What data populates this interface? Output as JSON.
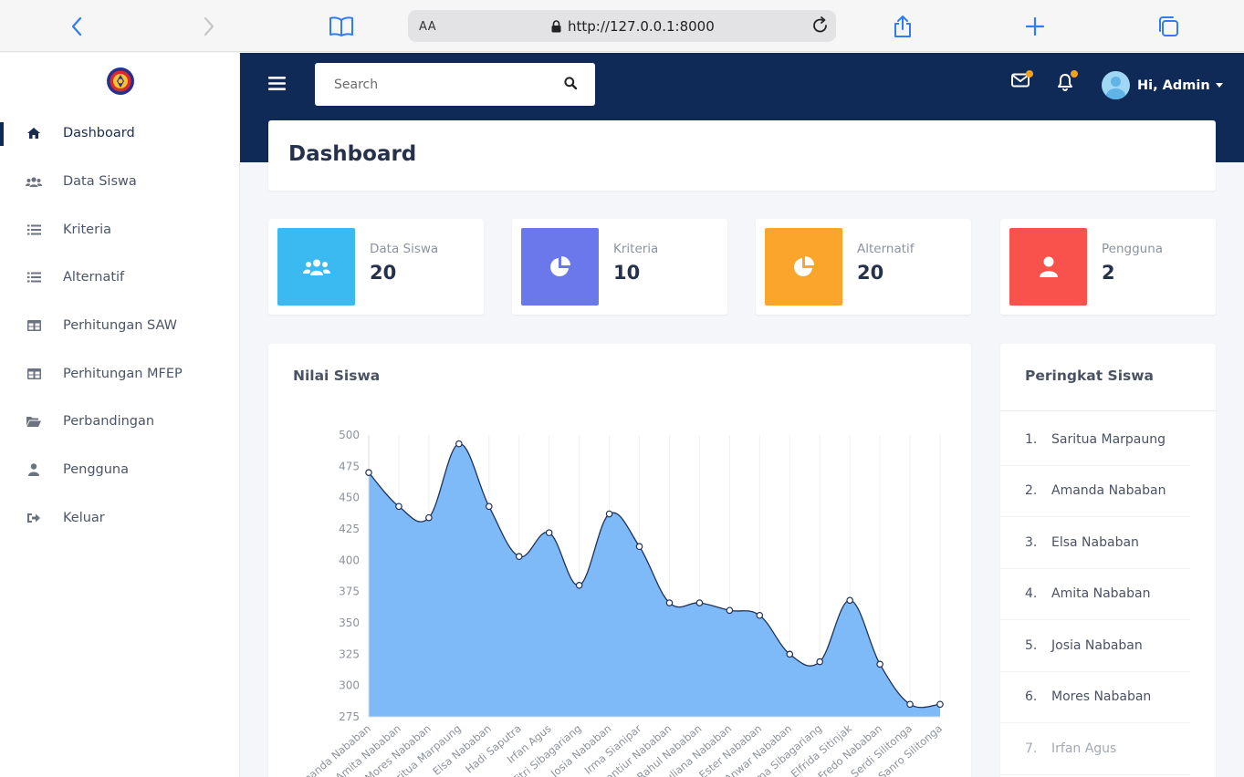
{
  "browser": {
    "text_size_label": "AA",
    "url": "http://127.0.0.1:8000"
  },
  "sidebar": {
    "items": [
      {
        "label": "Dashboard",
        "icon": "home-icon",
        "active": true
      },
      {
        "label": "Data Siswa",
        "icon": "users-icon"
      },
      {
        "label": "Kriteria",
        "icon": "list-icon"
      },
      {
        "label": "Alternatif",
        "icon": "list-icon"
      },
      {
        "label": "Perhitungan SAW",
        "icon": "table-icon"
      },
      {
        "label": "Perhitungan MFEP",
        "icon": "table-icon"
      },
      {
        "label": "Perbandingan",
        "icon": "folder-open-icon"
      },
      {
        "label": "Pengguna",
        "icon": "user-icon"
      },
      {
        "label": "Keluar",
        "icon": "sign-out-icon"
      }
    ]
  },
  "topbar": {
    "search_placeholder": "Search",
    "user_greeting": "Hi, Admin"
  },
  "page": {
    "title": "Dashboard"
  },
  "stats": [
    {
      "label": "Data Siswa",
      "value": "20",
      "color": "#3bbaf2",
      "icon": "users-icon"
    },
    {
      "label": "Kriteria",
      "value": "10",
      "color": "#6a78ec",
      "icon": "pie-chart-icon"
    },
    {
      "label": "Alternatif",
      "value": "20",
      "color": "#fca52c",
      "icon": "pie-chart-icon"
    },
    {
      "label": "Pengguna",
      "value": "2",
      "color": "#f9524c",
      "icon": "user-icon"
    }
  ],
  "chart": {
    "title": "Nilai Siswa"
  },
  "chart_data": {
    "type": "area",
    "title": "Nilai Siswa",
    "categories": [
      "Amanda Nababan",
      "Amita Nababan",
      "Mores Nababan",
      "Saritua Marpaung",
      "Elsa Nababan",
      "Hadi Saputra",
      "Irfan Agus",
      "Fitri Sibagariang",
      "Josia Nababan",
      "Irma Sianipar",
      "Mantiur Nababan",
      "Rahul Nababan",
      "Juliana Nababan",
      "Ester Nababan",
      "Anwar Nababan",
      "Nurma Sibagariang",
      "Elfrida Sitinjak",
      "Fredo Nababan",
      "Serdi Silitonga",
      "Sanro Silitonga"
    ],
    "values": [
      470,
      443,
      434,
      493,
      443,
      403,
      422,
      380,
      437,
      411,
      366,
      366,
      360,
      356,
      325,
      319,
      368,
      317,
      285,
      285
    ],
    "ylim": [
      275,
      500
    ],
    "yticks": [
      275,
      300,
      325,
      350,
      375,
      400,
      425,
      450,
      475,
      500
    ],
    "fill_color": "#7fbaf8",
    "line_color": "#1f3158",
    "grid": true
  },
  "ranking": {
    "title": "Peringkat Siswa",
    "items": [
      {
        "rank": "1.",
        "name": "Saritua Marpaung"
      },
      {
        "rank": "2.",
        "name": "Amanda Nababan"
      },
      {
        "rank": "3.",
        "name": "Elsa Nababan"
      },
      {
        "rank": "4.",
        "name": "Amita Nababan"
      },
      {
        "rank": "5.",
        "name": "Josia Nababan"
      },
      {
        "rank": "6.",
        "name": "Mores Nababan"
      },
      {
        "rank": "7.",
        "name": "Irfan Agus"
      }
    ]
  }
}
